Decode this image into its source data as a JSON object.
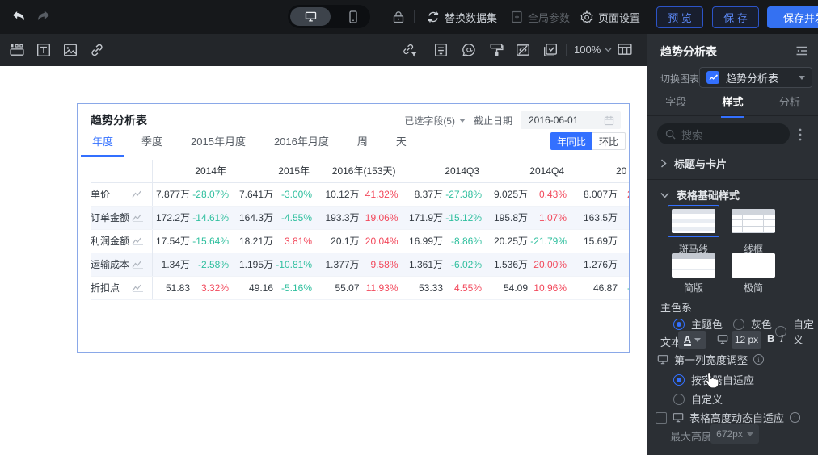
{
  "colors": {
    "accent": "#3370ff",
    "positive_red": "#f2495c",
    "negative_green": "#2fbf9e",
    "card_border": "#8aa8e8"
  },
  "topbar": {
    "replace_dataset": "替换数据集",
    "global_params": "全局参数",
    "page_settings": "页面设置",
    "preview": "预 览",
    "save": "保 存",
    "save_publish": "保存并发"
  },
  "toolbar": {
    "zoom_level": "100%"
  },
  "card": {
    "title": "趋势分析表",
    "selected_fields": "已选字段(5)",
    "deadline_label": "截止日期",
    "deadline_value": "2016-06-01",
    "tabs": [
      "年度",
      "季度",
      "2015年月度",
      "2016年月度",
      "周",
      "天"
    ],
    "compare_yoy": "年同比",
    "compare_mom": "环比"
  },
  "chart_data": {
    "type": "table",
    "title": "趋势分析表",
    "columns": [
      "2014年",
      "2015年",
      "2016年(153天)",
      "2014Q3",
      "2014Q4",
      "20"
    ],
    "rows": [
      {
        "label": "单价",
        "cells": [
          {
            "v": "7.877万",
            "p": "-28.07%"
          },
          {
            "v": "7.641万",
            "p": "-3.00%"
          },
          {
            "v": "10.12万",
            "p": "41.32%"
          },
          {
            "v": "8.37万",
            "p": "-27.38%"
          },
          {
            "v": "9.025万",
            "p": "0.43%"
          },
          {
            "v": "8.007万",
            "p": "2"
          }
        ]
      },
      {
        "label": "订单金额",
        "cells": [
          {
            "v": "172.2万",
            "p": "-14.61%"
          },
          {
            "v": "164.3万",
            "p": "-4.55%"
          },
          {
            "v": "193.3万",
            "p": "19.06%"
          },
          {
            "v": "171.9万",
            "p": "-15.12%"
          },
          {
            "v": "195.8万",
            "p": "1.07%"
          },
          {
            "v": "163.5万",
            "p": ""
          }
        ]
      },
      {
        "label": "利润金额",
        "cells": [
          {
            "v": "17.54万",
            "p": "-15.64%"
          },
          {
            "v": "18.21万",
            "p": "3.81%"
          },
          {
            "v": "20.1万",
            "p": "20.04%"
          },
          {
            "v": "16.99万",
            "p": "-8.86%"
          },
          {
            "v": "20.25万",
            "p": "-21.79%"
          },
          {
            "v": "15.69万",
            "p": ""
          }
        ]
      },
      {
        "label": "运输成本",
        "cells": [
          {
            "v": "1.34万",
            "p": "-2.58%"
          },
          {
            "v": "1.195万",
            "p": "-10.81%"
          },
          {
            "v": "1.377万",
            "p": "9.58%"
          },
          {
            "v": "1.361万",
            "p": "-6.02%"
          },
          {
            "v": "1.536万",
            "p": "20.00%"
          },
          {
            "v": "1.276万",
            "p": ""
          }
        ]
      },
      {
        "label": "折扣点",
        "cells": [
          {
            "v": "51.83",
            "p": "3.32%"
          },
          {
            "v": "49.16",
            "p": "-5.16%"
          },
          {
            "v": "55.07",
            "p": "11.93%"
          },
          {
            "v": "53.33",
            "p": "4.55%"
          },
          {
            "v": "54.09",
            "p": "10.96%"
          },
          {
            "v": "46.87",
            "p": "-"
          }
        ]
      }
    ]
  },
  "sidebar": {
    "panel_title": "趋势分析表",
    "switch_chart_label": "切换图表",
    "switch_chart_value": "趋势分析表",
    "tabs": [
      "字段",
      "样式",
      "分析"
    ],
    "search_placeholder": "搜索",
    "section_title_card": "标题与卡片",
    "section_table_style": "表格基础样式",
    "style_options": [
      "斑马线",
      "线框",
      "简版",
      "极简"
    ],
    "primary_color_label": "主色系",
    "color_options": [
      "主题色",
      "灰色",
      "自定义"
    ],
    "text_label": "文本",
    "font_color_button": "A",
    "font_size": "12 px",
    "bold_label": "B",
    "italic_label": "I",
    "first_col_label": "第一列宽度调整",
    "width_options": [
      "按容器自适应",
      "自定义"
    ],
    "height_auto_label": "表格高度动态自适应",
    "max_height_label": "最大高度",
    "max_height_value": "672px"
  }
}
